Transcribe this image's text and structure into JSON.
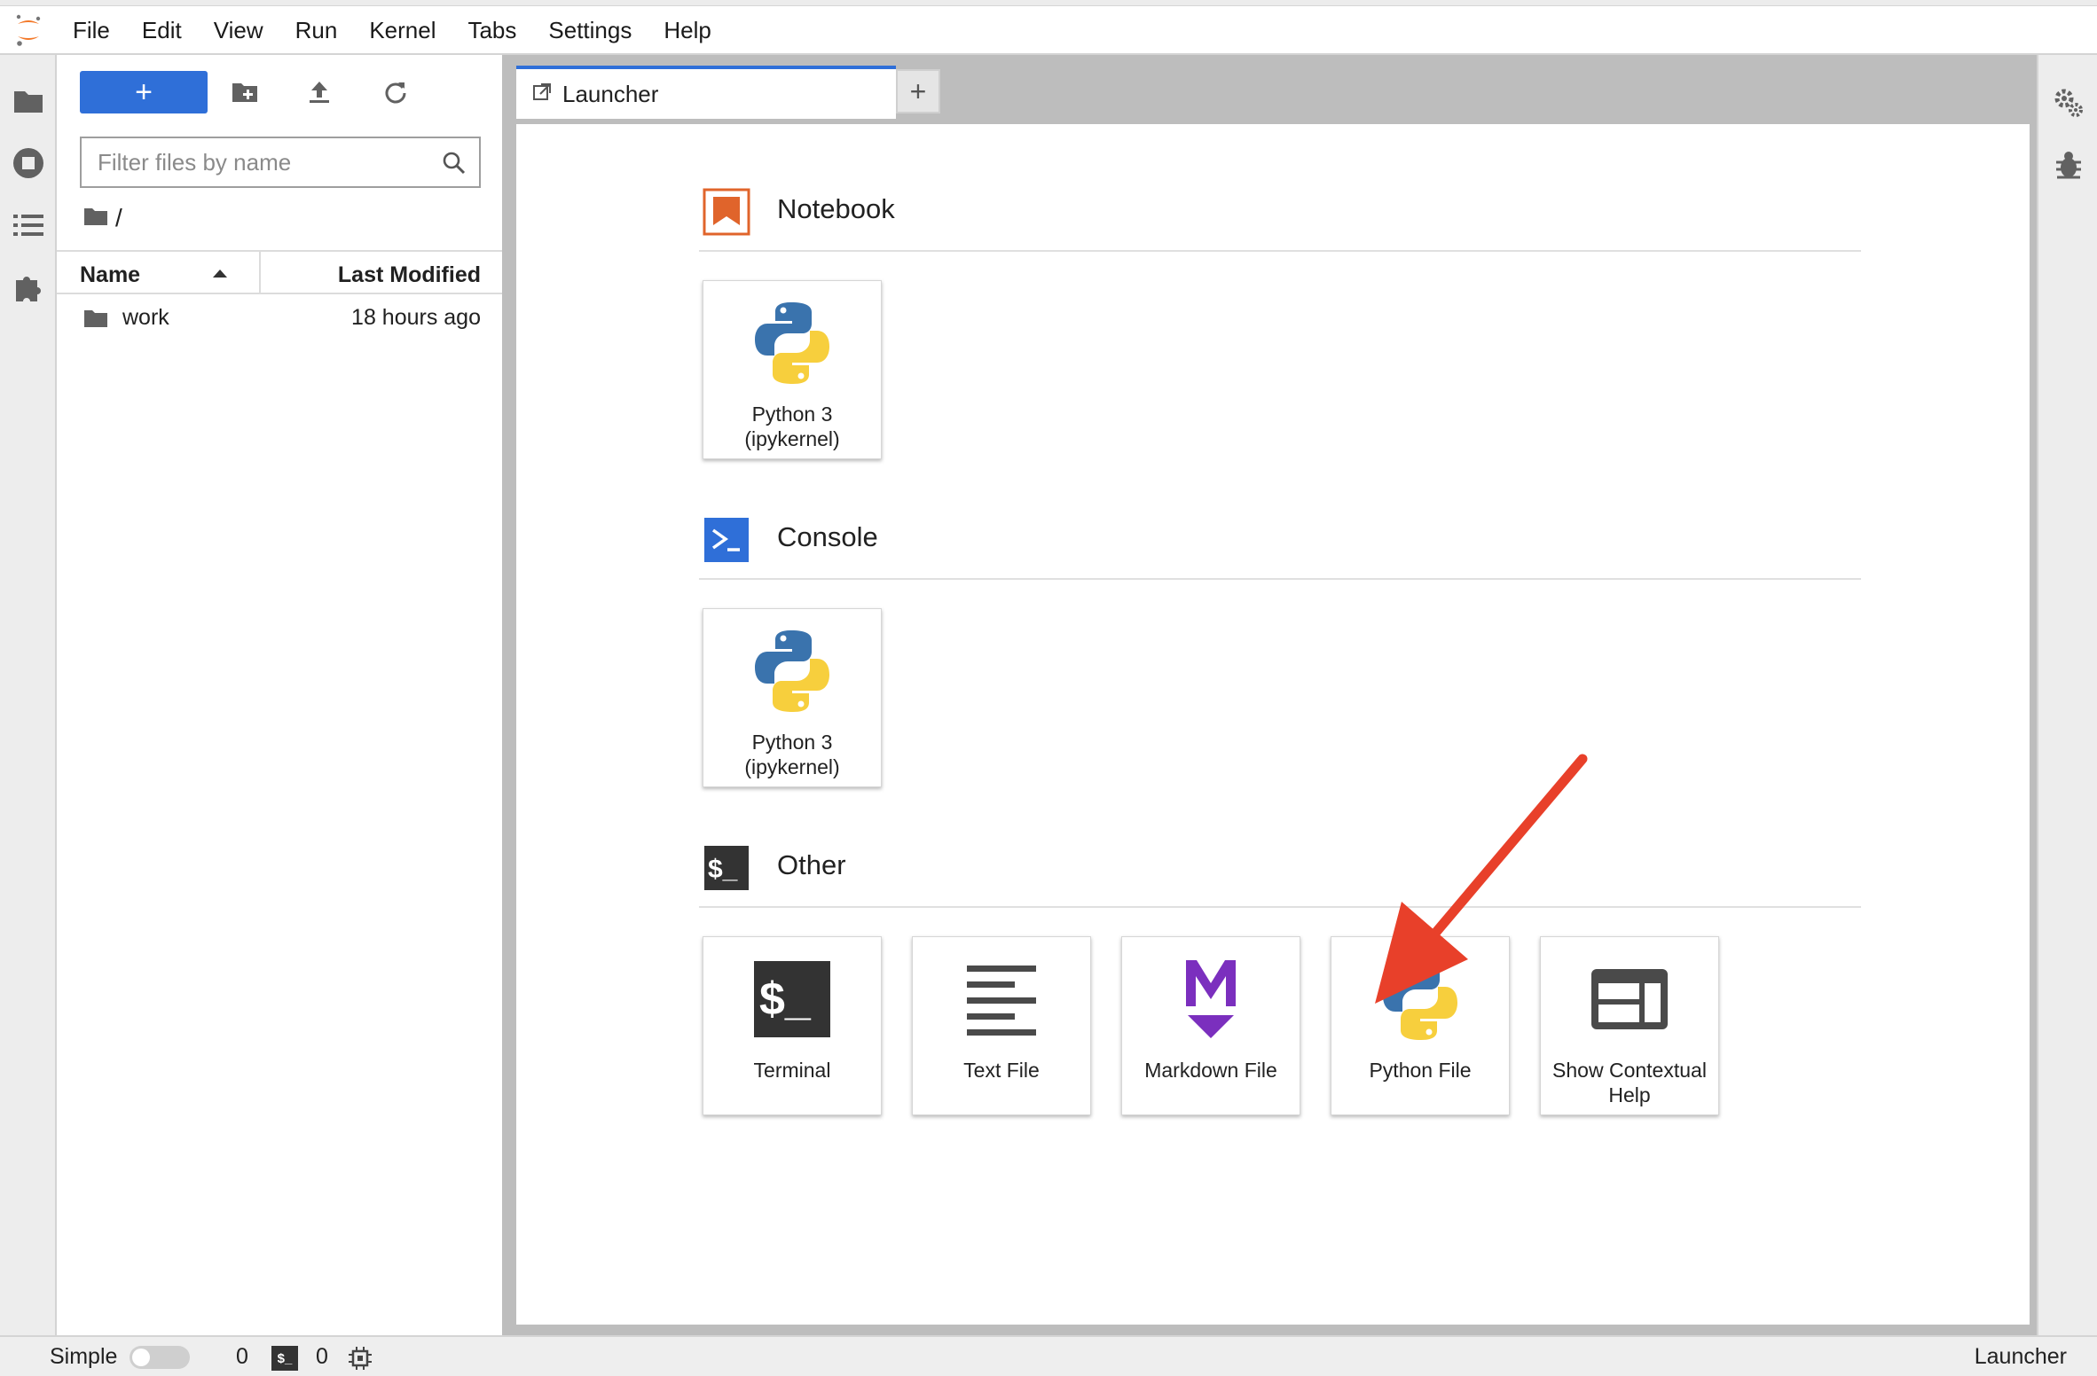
{
  "menubar": {
    "logo": "jupyter-logo-icon",
    "items": [
      "File",
      "Edit",
      "View",
      "Run",
      "Kernel",
      "Tabs",
      "Settings",
      "Help"
    ]
  },
  "filebrowser": {
    "new_button_label": "+",
    "filter_placeholder": "Filter files by name",
    "breadcrumb": "/",
    "columns": {
      "name": "Name",
      "modified": "Last Modified"
    },
    "rows": [
      {
        "name": "work",
        "modified": "18 hours ago",
        "type": "folder"
      }
    ]
  },
  "tabs": [
    {
      "label": "Launcher"
    }
  ],
  "launcher": {
    "sections": [
      {
        "title": "Notebook",
        "cards": [
          {
            "label": "Python 3 (ipykernel)",
            "icon": "python-logo-icon"
          }
        ]
      },
      {
        "title": "Console",
        "cards": [
          {
            "label": "Python 3 (ipykernel)",
            "icon": "python-logo-icon"
          }
        ]
      },
      {
        "title": "Other",
        "cards": [
          {
            "label": "Terminal",
            "icon": "terminal-icon"
          },
          {
            "label": "Text File",
            "icon": "text-file-icon"
          },
          {
            "label": "Markdown File",
            "icon": "markdown-icon"
          },
          {
            "label": "Python File",
            "icon": "python-logo-icon"
          },
          {
            "label": "Show Contextual Help",
            "icon": "contextual-help-icon"
          }
        ]
      }
    ]
  },
  "statusbar": {
    "mode_label": "Simple",
    "kernels_count": "0",
    "terminal_badge": "$_",
    "terminals_count": "0",
    "right_label": "Launcher"
  },
  "colors": {
    "accent": "#2f6fd8",
    "notebook_icon": "#e0642b",
    "console_icon": "#2f6fd8",
    "markdown_icon": "#7b2fbe",
    "annotation_arrow": "#e8402a"
  }
}
